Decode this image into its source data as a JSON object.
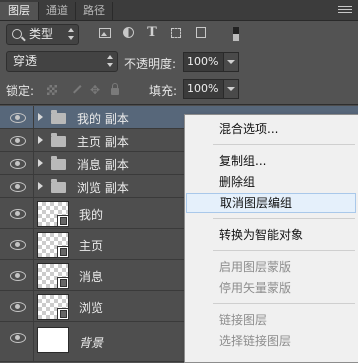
{
  "tabs": [
    "图层",
    "通道",
    "路径"
  ],
  "filter": {
    "kind_label": "类型"
  },
  "blend": {
    "mode": "穿透",
    "opacity_label": "不透明度:",
    "opacity_value": "100%"
  },
  "lock": {
    "label": "锁定:",
    "fill_label": "填充:",
    "fill_value": "100%"
  },
  "layers": [
    {
      "name": "我的 副本",
      "type": "group",
      "selected": true
    },
    {
      "name": "主页 副本",
      "type": "group"
    },
    {
      "name": "消息 副本",
      "type": "group"
    },
    {
      "name": "浏览 副本",
      "type": "group"
    },
    {
      "name": "我的",
      "type": "smart"
    },
    {
      "name": "主页",
      "type": "smart"
    },
    {
      "name": "消息",
      "type": "smart"
    },
    {
      "name": "浏览",
      "type": "smart"
    },
    {
      "name": "背景",
      "type": "background"
    }
  ],
  "context_menu": [
    {
      "label": "混合选项...",
      "disabled": false
    },
    {
      "label": "复制组...",
      "disabled": false
    },
    {
      "label": "删除组",
      "disabled": false
    },
    {
      "label": "取消图层编组",
      "disabled": false,
      "highlighted": true
    },
    {
      "label": "转换为智能对象",
      "disabled": false
    },
    {
      "label": "启用图层蒙版",
      "disabled": true
    },
    {
      "label": "停用矢量蒙版",
      "disabled": true
    },
    {
      "label": "链接图层",
      "disabled": true
    },
    {
      "label": "选择链接图层",
      "disabled": true
    }
  ],
  "icons": {
    "layer_visibility": "eye-icon",
    "group": "folder-icon",
    "search": "search-icon",
    "panel_menu": "panel-menu-icon"
  },
  "colors": {
    "panel": "#535353",
    "selected_layer": "#57677a",
    "menu_bg": "#f0f0f0",
    "menu_highlight": "#e5f0fb"
  }
}
